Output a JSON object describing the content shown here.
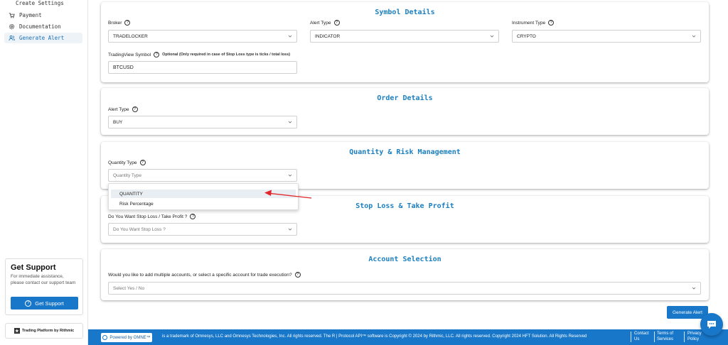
{
  "sidebar": {
    "top_item": "Create Settings",
    "items": [
      {
        "label": "Payment",
        "icon": "cart-icon"
      },
      {
        "label": "Documentation",
        "icon": "gear-icon"
      },
      {
        "label": "Generate Alert",
        "icon": "users-icon"
      }
    ],
    "support": {
      "title": "Get Support",
      "text": "For immediate assistance, please contact our support team",
      "button": "Get Support"
    },
    "rithmic": "Trading Platform by Rithmic"
  },
  "symbol": {
    "title": "Symbol Details",
    "broker_label": "Broker",
    "broker_value": "TRADELOCKER",
    "alert_type_label": "Alert Type",
    "alert_type_value": "INDICATOR",
    "instrument_label": "Instrument Type",
    "instrument_value": "CRYPTO",
    "tv_label": "TradingView Symbol",
    "tv_optional": "Optional (Only required in case of Stop Loss type is ticks / total loss)",
    "tv_value": "BTCUSD"
  },
  "order": {
    "title": "Order Details",
    "alert_type_label": "Alert Type",
    "alert_type_value": "BUY"
  },
  "quantity": {
    "title": "Quantity & Risk Management",
    "label": "Quantity Type",
    "placeholder": "Quantity Type",
    "options": [
      "QUANTITY",
      "Risk Percentage"
    ]
  },
  "stoploss": {
    "title": "Stop Loss & Take Profit",
    "label": "Do You Want Stop Loss / Take Profit ?",
    "placeholder": "Do You Want Stop Loss ?"
  },
  "account": {
    "title": "Account Selection",
    "label": "Would you like to add multiple accounts, or select a specific account for trade execution?",
    "placeholder": "Select Yes / No"
  },
  "generate_button": "Generate Alert",
  "footer": {
    "powered": "Powered by OMNE™",
    "text": "is a trademark of Omnesys, LLC and Omnesys Technologies, Inc. All rights reserved. The R | Protocol API™ software is Copyright © 2024 by Rithmic, LLC. All rights reserved. Copyright 2024 HFT Solution. All Rights Reserved",
    "contact": [
      "Contact",
      "Us"
    ],
    "terms": [
      "Terms of",
      "Services"
    ],
    "privacy": [
      "Privacy",
      "Policy"
    ]
  },
  "colors": {
    "accent": "#1877c9",
    "title": "#1a7fc0",
    "arrow": "#e0262b"
  }
}
